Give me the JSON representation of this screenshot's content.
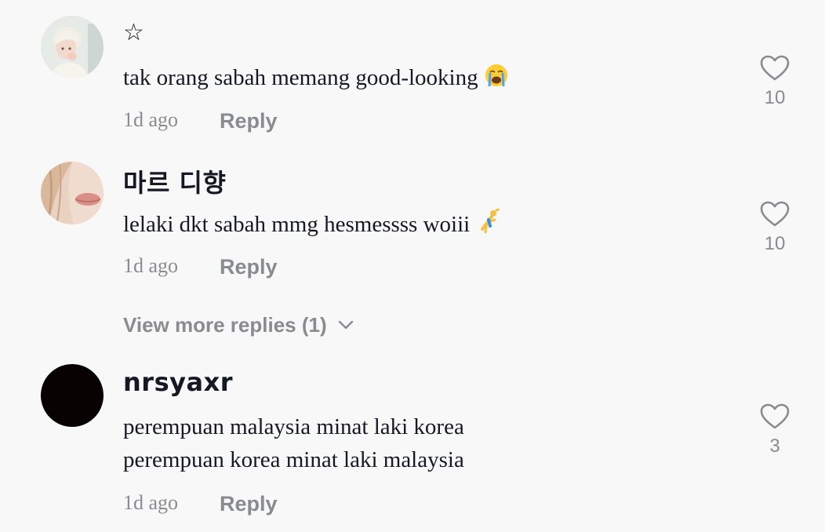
{
  "comments": [
    {
      "username": "☆",
      "text_lines": [
        "tak orang sabah memang good-looking"
      ],
      "emoji": "loudly-crying-face",
      "time": "1d ago",
      "reply_label": "Reply",
      "likes": "10"
    },
    {
      "username": "마르 디향",
      "text_lines": [
        "lelaki dkt sabah mmg hesmessss woiii"
      ],
      "emoji": "person-cartwheeling",
      "time": "1d ago",
      "reply_label": "Reply",
      "likes": "10"
    },
    {
      "username": "nrsyaxr",
      "text_lines": [
        "perempuan malaysia minat laki korea",
        "perempuan korea minat laki malaysia"
      ],
      "time": "1d ago",
      "reply_label": "Reply",
      "likes": "3"
    }
  ],
  "view_more_replies": "View more replies (1)",
  "colors": {
    "background": "#f8f8f8",
    "text_primary": "#161823",
    "text_secondary": "#8a8b91"
  }
}
